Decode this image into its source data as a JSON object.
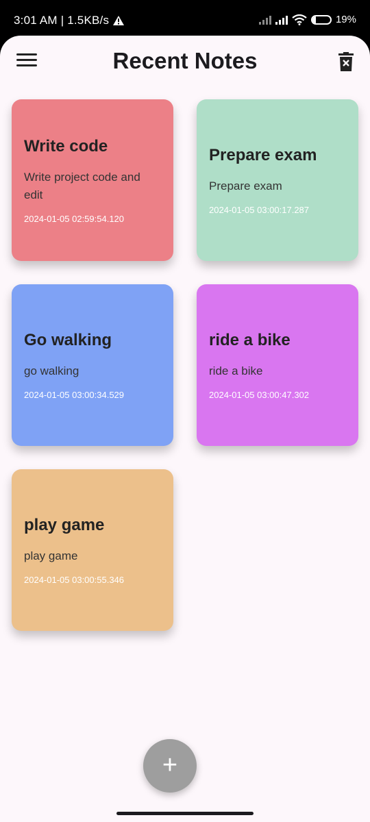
{
  "status_bar": {
    "time_speed": "3:01 AM | 1.5KB/s",
    "battery_text": "19%",
    "battery_level": 0.19,
    "warning_icon": "warning-triangle-icon"
  },
  "header": {
    "title": "Recent Notes",
    "menu_icon": "hamburger-menu-icon",
    "delete_icon": "trash-icon"
  },
  "notes": [
    {
      "title": "Write code",
      "body": "Write project code and edit",
      "timestamp": "2024-01-05 02:59:54.120",
      "color": "#ec8087"
    },
    {
      "title": "Prepare exam",
      "body": "Prepare exam",
      "timestamp": "2024-01-05 03:00:17.287",
      "color": "#afdec8"
    },
    {
      "title": "Go walking",
      "body": "go walking",
      "timestamp": "2024-01-05 03:00:34.529",
      "color": "#7fa2f5"
    },
    {
      "title": "ride a bike",
      "body": "ride a bike",
      "timestamp": "2024-01-05 03:00:47.302",
      "color": "#d976f0"
    },
    {
      "title": "play game",
      "body": "play game",
      "timestamp": "2024-01-05 03:00:55.346",
      "color": "#ecc08b"
    }
  ],
  "fab": {
    "label": "+",
    "icon": "plus-icon"
  }
}
